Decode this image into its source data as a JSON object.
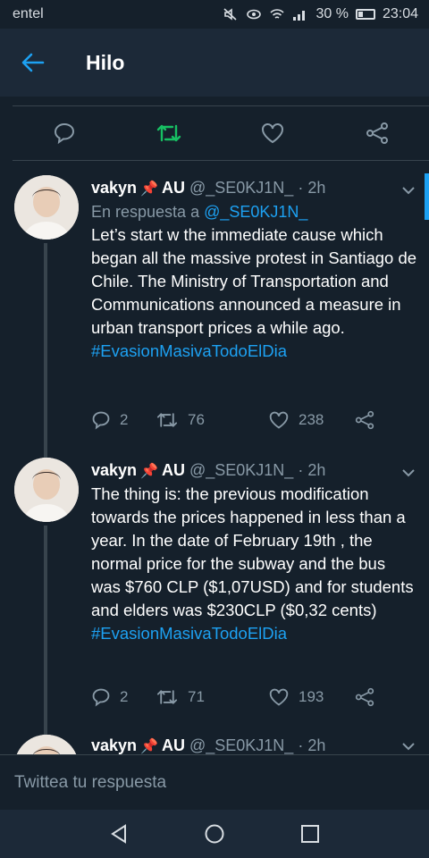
{
  "status_bar": {
    "carrier": "entel",
    "battery": "30 %",
    "time": "23:04"
  },
  "header": {
    "title": "Hilo"
  },
  "compose": {
    "placeholder": "Twittea tu respuesta"
  },
  "tweets": [
    {
      "display_name": "vakyn",
      "suffix": "AU",
      "handle": "@_SE0KJ1N_",
      "time": "· 2h",
      "reply_prefix": "En respuesta a",
      "reply_handle": "@_SE0KJ1N_",
      "text": "Let’s start w the immediate cause which began all the massive protest in Santiago de Chile. The Ministry of Transportation and Communications announced a measure in urban transport prices a while ago.",
      "hashtag": "#EvasionMasivaTodoElDia",
      "replies": "2",
      "retweets": "76",
      "likes": "238"
    },
    {
      "display_name": "vakyn",
      "suffix": "AU",
      "handle": "@_SE0KJ1N_",
      "time": "· 2h",
      "text": "The thing is: the previous modification towards the prices happened in less than a year. In the date of February 19th , the normal price for the subway and the bus was $760 CLP ($1,07USD) and for students and elders was $230CLP ($0,32 cents)",
      "hashtag": "#EvasionMasivaTodoElDia",
      "replies": "2",
      "retweets": "71",
      "likes": "193"
    },
    {
      "display_name": "vakyn",
      "suffix": "AU",
      "handle": "@_SE0KJ1N_",
      "time": "· 2h"
    }
  ],
  "colors": {
    "background": "#15202b",
    "bar": "#1c2938",
    "accent": "#1da1f2",
    "retweet_active": "#17bf63",
    "muted": "#8899a6",
    "divider": "#38444d"
  }
}
